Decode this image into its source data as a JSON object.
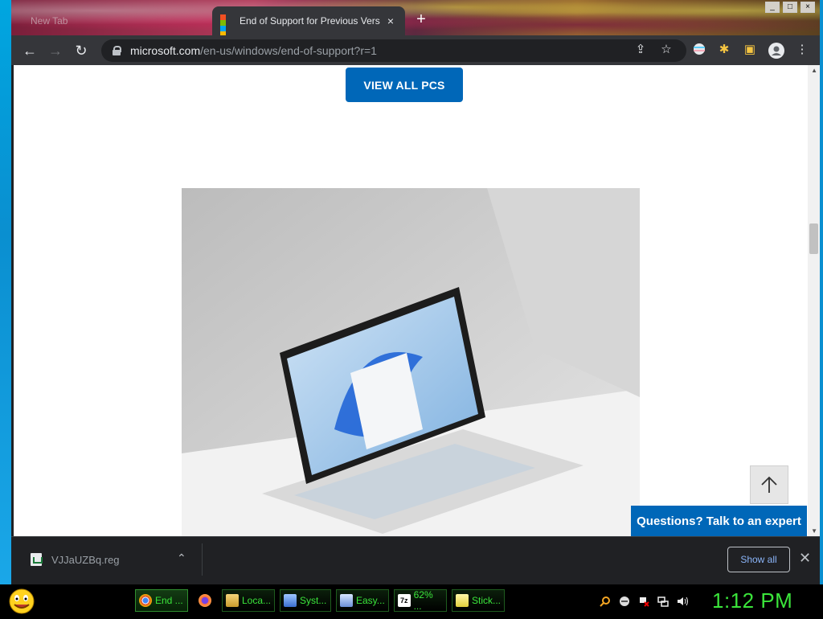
{
  "browser": {
    "tabs": [
      {
        "title": "New Tab",
        "active": false
      },
      {
        "title": "End of Support for Previous Vers",
        "active": true
      }
    ],
    "window_controls": [
      "_",
      "□",
      "×"
    ],
    "url_host": "microsoft.com",
    "url_path": "/en-us/windows/end-of-support?r=1"
  },
  "page": {
    "view_all_label": "VIEW ALL PCS",
    "expert_label": "Questions? Talk to an expert"
  },
  "download_shelf": {
    "file_name": "VJJaUZBq.reg",
    "show_all_label": "Show all"
  },
  "taskbar": {
    "items": [
      {
        "label": "End ...",
        "icon": "chrome-icon",
        "active": true
      },
      {
        "label": "",
        "icon": "firefox-icon",
        "active": false
      },
      {
        "label": "Loca...",
        "icon": "folder-icon",
        "active": false
      },
      {
        "label": "Syst...",
        "icon": "system-icon",
        "active": false
      },
      {
        "label": "Easy...",
        "icon": "easy-icon",
        "active": false
      },
      {
        "label": "62% ...",
        "icon": "7zip-icon",
        "active": false
      },
      {
        "label": "Stick...",
        "icon": "sticky-icon",
        "active": false
      }
    ],
    "clock": "1:12 PM"
  },
  "colors": {
    "ms_blue": "#0067b8",
    "taskbar_text": "#3be53b"
  }
}
